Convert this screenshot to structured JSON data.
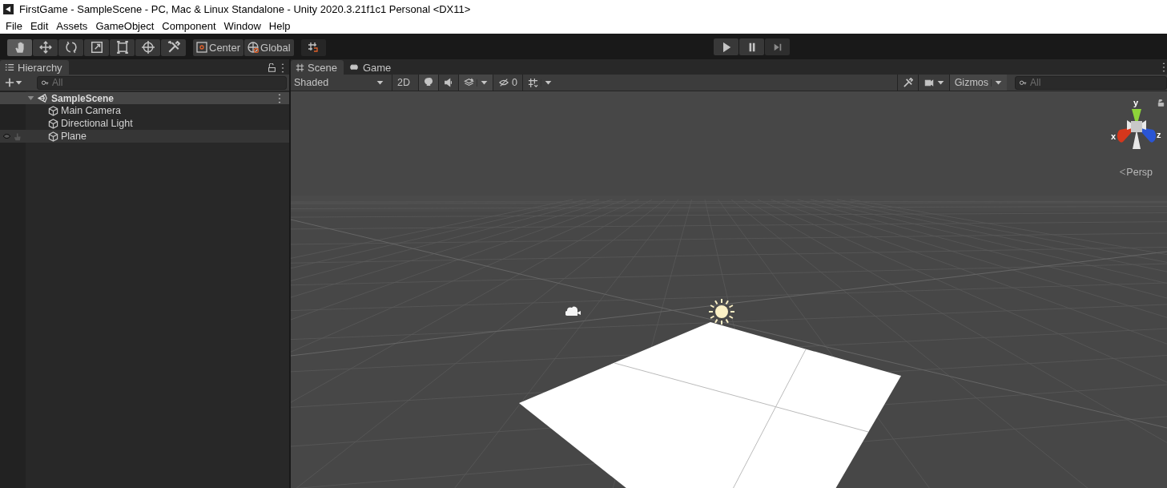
{
  "window": {
    "title": "FirstGame - SampleScene - PC, Mac & Linux Standalone - Unity 2020.3.21f1c1 Personal <DX11>"
  },
  "menu": [
    "File",
    "Edit",
    "Assets",
    "GameObject",
    "Component",
    "Window",
    "Help"
  ],
  "tools": [
    {
      "kind": "hand",
      "selected": true
    },
    {
      "kind": "move",
      "selected": false
    },
    {
      "kind": "rotate",
      "selected": false
    },
    {
      "kind": "scale",
      "selected": false
    },
    {
      "kind": "rect",
      "selected": false
    },
    {
      "kind": "transform",
      "selected": false
    },
    {
      "kind": "custom",
      "selected": false
    }
  ],
  "pivot": {
    "position": "Center",
    "rotation": "Global"
  },
  "hierarchy": {
    "title": "Hierarchy",
    "search": {
      "placeholder": "All"
    },
    "scene": {
      "name": "SampleScene",
      "expanded": true,
      "children": [
        {
          "name": "Main Camera",
          "hovered": false
        },
        {
          "name": "Directional Light",
          "hovered": false
        },
        {
          "name": "Plane",
          "hovered": true
        }
      ]
    }
  },
  "scene_tabs": [
    {
      "label": "Scene",
      "selected": true
    },
    {
      "label": "Game",
      "selected": false
    }
  ],
  "scene_toolbar": {
    "shading": "Shaded",
    "mode_2d": "2D",
    "hidden_count": "0",
    "gizmos": "Gizmos",
    "search": {
      "placeholder": "All"
    }
  },
  "axis_gizmo": {
    "x": "x",
    "y": "y",
    "z": "z",
    "projection": "Persp"
  }
}
